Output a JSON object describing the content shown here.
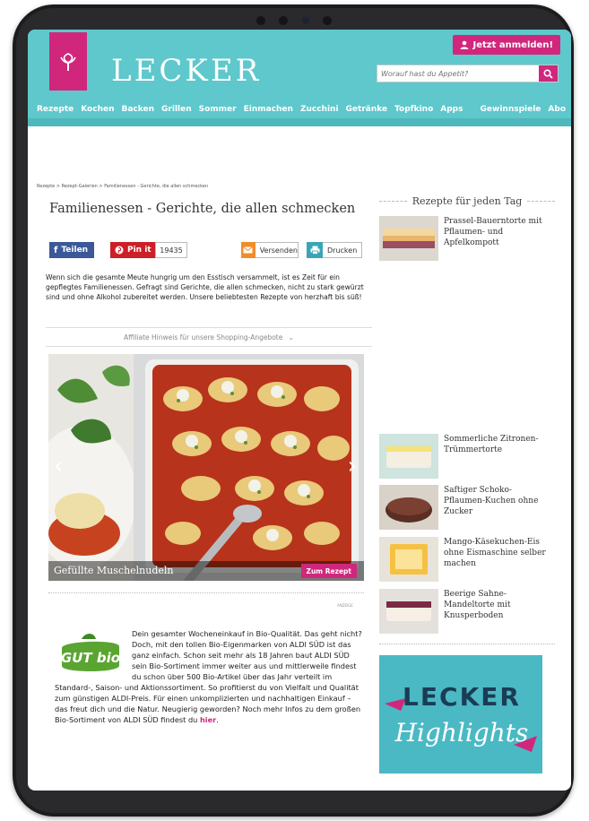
{
  "header": {
    "logo_text": "LECKER",
    "login_label": "Jetzt anmelden!",
    "search_placeholder": "Worauf hast du Appetit?"
  },
  "nav": {
    "items": [
      "Rezepte",
      "Kochen",
      "Backen",
      "Grillen",
      "Sommer",
      "Einmachen",
      "Zucchini",
      "Getränke",
      "Topfkino",
      "Apps"
    ],
    "right_items": [
      "Gewinnspiele",
      "Abo"
    ]
  },
  "article": {
    "breadcrumb": "Rezepte > Rezept-Galerien > Familienessen - Gerichte, die allen schmecken",
    "title": "Familienessen - Gerichte, die allen schmecken",
    "share": {
      "facebook": "Teilen",
      "pinterest": "Pin it",
      "pin_count": "19435",
      "mail": "Versenden",
      "print": "Drucken"
    },
    "intro": "Wenn sich die gesamte Meute hungrig um den Esstisch versammelt, ist es Zeit für ein gepflegtes Familienessen. Gefragt sind Gerichte, die allen schmecken, nicht zu stark gewürzt sind und ohne Alkohol zubereitet werden. Unsere beliebtesten Rezepte von herzhaft bis süß!",
    "affiliate": "Affiliate Hinweis für unsere Shopping-Angebote"
  },
  "gallery": {
    "caption": "Gefüllte Muschelnudeln",
    "button": "Zum Rezept"
  },
  "ad": {
    "label": "ANZEIGE",
    "logo_text": "GUT bio",
    "text": "Dein gesamter Wocheneinkauf in Bio-Qualität. Das geht nicht? Doch, mit den tollen Bio-Eigenmarken von ALDI SÜD ist das ganz einfach. Schon seit mehr als 18 Jahren baut ALDI SÜD sein Bio-Sortiment immer weiter aus und mittlerweile findest du schon über 500 Bio-Artikel über das Jahr verteilt im Standard-, Saison- und Aktionssortiment. So profitierst du von Vielfalt und Qualität zum günstigen ALDI-Preis. Für einen unkomplizierten und nachhaltigen Einkauf – das freut dich und die Natur. Neugierig geworden? Noch mehr Infos zu dem großen Bio-Sortiment von ALDI SÜD findest du",
    "link": "hier",
    "end": "."
  },
  "sidebar": {
    "title": "Rezepte für jeden Tag",
    "items": [
      {
        "title": "Prassel-Bauerntorte mit Pflaumen- und Apfelkompott"
      },
      {
        "title": "Sommerliche Zitronen-Trümmertorte"
      },
      {
        "title": "Saftiger Schoko-Pflaumen-Kuchen ohne Zucker"
      },
      {
        "title": "Mango-Käsekuchen-Eis ohne Eismaschine selber machen"
      },
      {
        "title": "Beerige Sahne-Mandeltorte mit Knusperboden"
      }
    ],
    "highlights": {
      "line1": "LECKER",
      "line2": "Highlights"
    }
  },
  "colors": {
    "brand_teal": "#5ec8cc",
    "brand_pink": "#d0277c",
    "facebook": "#3b5998",
    "pinterest": "#cb2027"
  }
}
